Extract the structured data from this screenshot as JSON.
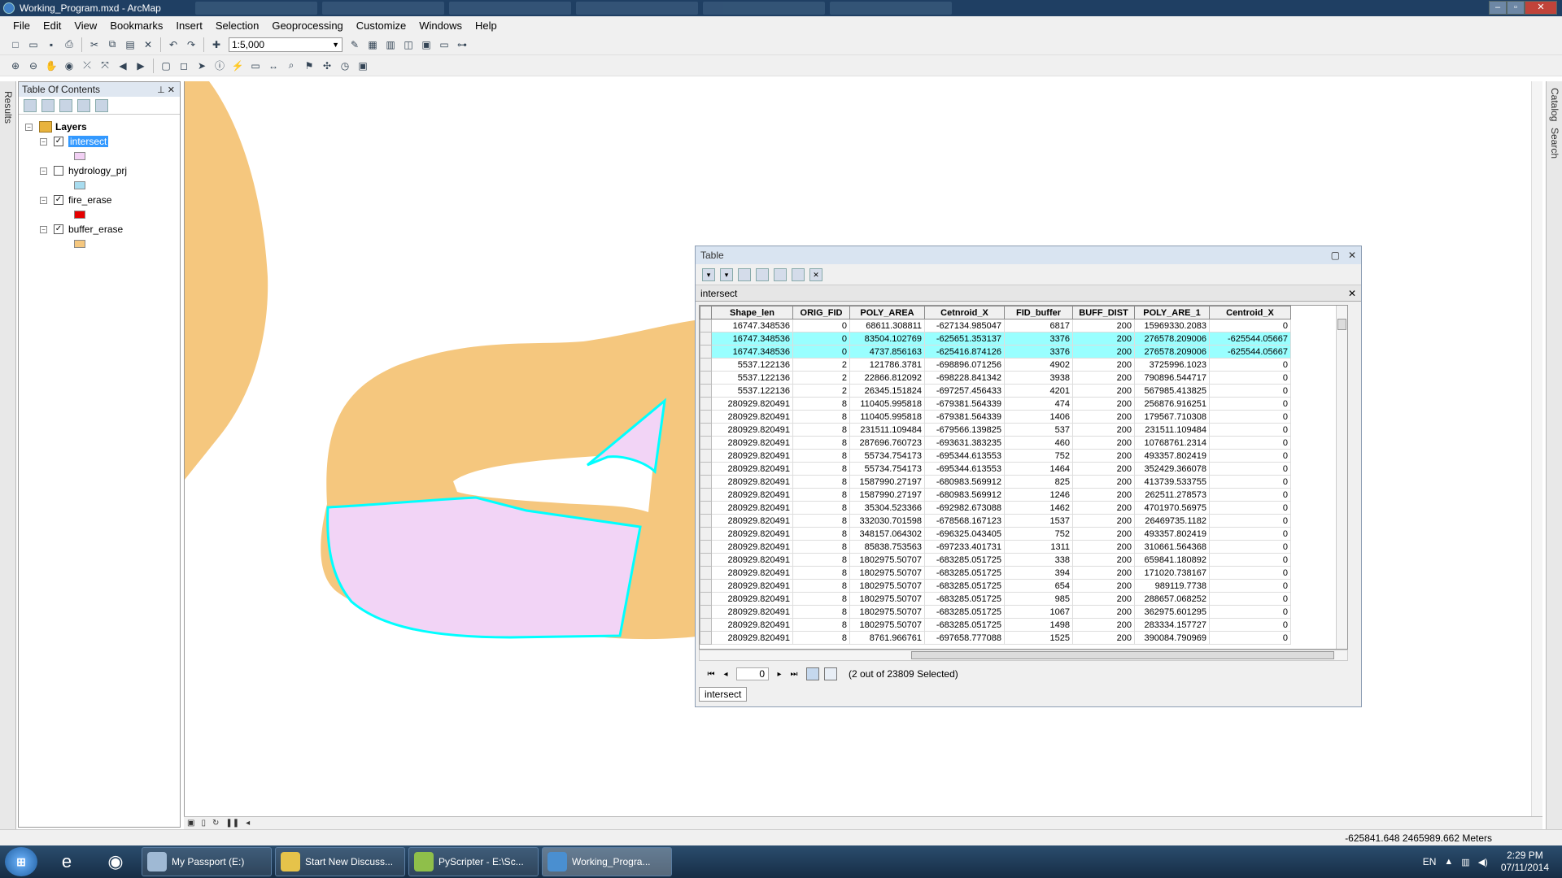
{
  "window": {
    "title": "Working_Program.mxd - ArcMap",
    "minimize": "–",
    "maximize": "▫",
    "close": "✕"
  },
  "menu": [
    "File",
    "Edit",
    "View",
    "Bookmarks",
    "Insert",
    "Selection",
    "Geoprocessing",
    "Customize",
    "Windows",
    "Help"
  ],
  "toolbar": {
    "scale": "1:5,000"
  },
  "side_tabs": {
    "left": "Results",
    "right_top": "Catalog",
    "right_bottom": "Search"
  },
  "toc": {
    "title": "Table Of Contents",
    "root": "Layers",
    "layers": [
      {
        "name": "intersect",
        "checked": true,
        "color": "#f2d0f4"
      },
      {
        "name": "hydrology_prj",
        "checked": false,
        "color": "#a8dcef"
      },
      {
        "name": "fire_erase",
        "checked": true,
        "color": "#e60000"
      },
      {
        "name": "buffer_erase",
        "checked": true,
        "color": "#f5c77e"
      }
    ]
  },
  "map_colors": {
    "buffer": "#f5c77e",
    "intersect": "#f2d4f6",
    "selection": "#00ffff"
  },
  "table": {
    "title": "Table",
    "layer": "intersect",
    "columns": [
      "Shape_len",
      "ORIG_FID",
      "POLY_AREA",
      "Cetnroid_X",
      "FID_buffer",
      "BUFF_DIST",
      "POLY_ARE_1",
      "Centroid_X"
    ],
    "rows": [
      [
        "16747.348536",
        "0",
        "68611.308811",
        "-627134.985047",
        "6817",
        "200",
        "15969330.2083",
        "0"
      ],
      [
        "16747.348536",
        "0",
        "83504.102769",
        "-625651.353137",
        "3376",
        "200",
        "276578.209006",
        "-625544.05667"
      ],
      [
        "16747.348536",
        "0",
        "4737.856163",
        "-625416.874126",
        "3376",
        "200",
        "276578.209006",
        "-625544.05667"
      ],
      [
        "5537.122136",
        "2",
        "121786.3781",
        "-698896.071256",
        "4902",
        "200",
        "3725996.1023",
        "0"
      ],
      [
        "5537.122136",
        "2",
        "22866.812092",
        "-698228.841342",
        "3938",
        "200",
        "790896.544717",
        "0"
      ],
      [
        "5537.122136",
        "2",
        "26345.151824",
        "-697257.456433",
        "4201",
        "200",
        "567985.413825",
        "0"
      ],
      [
        "280929.820491",
        "8",
        "110405.995818",
        "-679381.564339",
        "474",
        "200",
        "256876.916251",
        "0"
      ],
      [
        "280929.820491",
        "8",
        "110405.995818",
        "-679381.564339",
        "1406",
        "200",
        "179567.710308",
        "0"
      ],
      [
        "280929.820491",
        "8",
        "231511.109484",
        "-679566.139825",
        "537",
        "200",
        "231511.109484",
        "0"
      ],
      [
        "280929.820491",
        "8",
        "287696.760723",
        "-693631.383235",
        "460",
        "200",
        "10768761.2314",
        "0"
      ],
      [
        "280929.820491",
        "8",
        "55734.754173",
        "-695344.613553",
        "752",
        "200",
        "493357.802419",
        "0"
      ],
      [
        "280929.820491",
        "8",
        "55734.754173",
        "-695344.613553",
        "1464",
        "200",
        "352429.366078",
        "0"
      ],
      [
        "280929.820491",
        "8",
        "1587990.27197",
        "-680983.569912",
        "825",
        "200",
        "413739.533755",
        "0"
      ],
      [
        "280929.820491",
        "8",
        "1587990.27197",
        "-680983.569912",
        "1246",
        "200",
        "262511.278573",
        "0"
      ],
      [
        "280929.820491",
        "8",
        "35304.523366",
        "-692982.673088",
        "1462",
        "200",
        "4701970.56975",
        "0"
      ],
      [
        "280929.820491",
        "8",
        "332030.701598",
        "-678568.167123",
        "1537",
        "200",
        "26469735.1182",
        "0"
      ],
      [
        "280929.820491",
        "8",
        "348157.064302",
        "-696325.043405",
        "752",
        "200",
        "493357.802419",
        "0"
      ],
      [
        "280929.820491",
        "8",
        "85838.753563",
        "-697233.401731",
        "1311",
        "200",
        "310661.564368",
        "0"
      ],
      [
        "280929.820491",
        "8",
        "1802975.50707",
        "-683285.051725",
        "338",
        "200",
        "659841.180892",
        "0"
      ],
      [
        "280929.820491",
        "8",
        "1802975.50707",
        "-683285.051725",
        "394",
        "200",
        "171020.738167",
        "0"
      ],
      [
        "280929.820491",
        "8",
        "1802975.50707",
        "-683285.051725",
        "654",
        "200",
        "989119.7738",
        "0"
      ],
      [
        "280929.820491",
        "8",
        "1802975.50707",
        "-683285.051725",
        "985",
        "200",
        "288657.068252",
        "0"
      ],
      [
        "280929.820491",
        "8",
        "1802975.50707",
        "-683285.051725",
        "1067",
        "200",
        "362975.601295",
        "0"
      ],
      [
        "280929.820491",
        "8",
        "1802975.50707",
        "-683285.051725",
        "1498",
        "200",
        "283334.157727",
        "0"
      ],
      [
        "280929.820491",
        "8",
        "8761.966761",
        "-697658.777088",
        "1525",
        "200",
        "390084.790969",
        "0"
      ]
    ],
    "highlighted_rows": [
      1,
      2
    ],
    "record": "0",
    "selection_text": "(2 out of 23809 Selected)",
    "tab": "intersect"
  },
  "status": {
    "coords": "-625841.648  2465989.662 Meters"
  },
  "taskbar": {
    "tasks": [
      "My Passport (E:)",
      "Start New Discuss...",
      "PyScripter - E:\\Sc...",
      "Working_Progra..."
    ],
    "lang": "EN",
    "time": "2:29 PM",
    "date": "07/11/2014"
  }
}
